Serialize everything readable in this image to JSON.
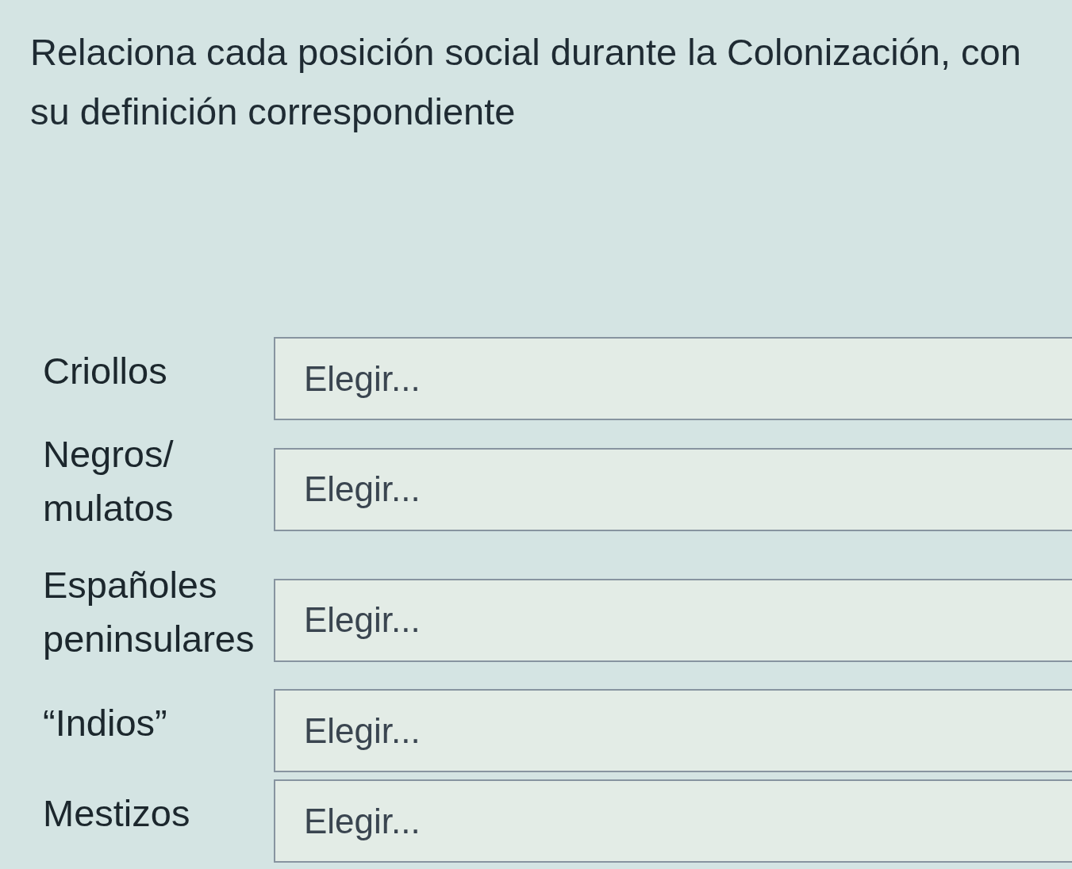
{
  "question": "Relaciona cada posición social durante la Colonización, con su definición correspondiente",
  "pairs": [
    {
      "term": "Criollos",
      "choice": "Elegir..."
    },
    {
      "term": "Negros/ mulatos",
      "choice": "Elegir..."
    },
    {
      "term": "Españoles peninsulares",
      "choice": "Elegir..."
    },
    {
      "term": "“Indios”",
      "choice": "Elegir..."
    },
    {
      "term": "Mestizos",
      "choice": "Elegir..."
    }
  ]
}
